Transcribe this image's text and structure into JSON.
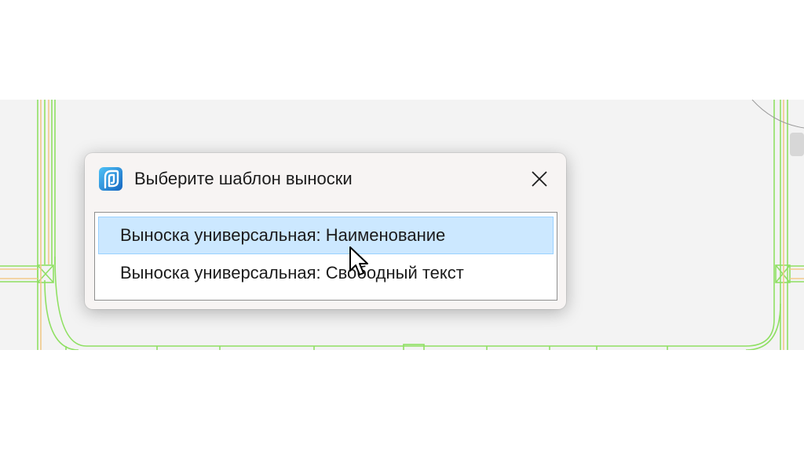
{
  "dialog": {
    "title": "Выберите шаблон выноски",
    "close_icon": "close-icon",
    "app_icon": "app-logo-icon",
    "items": [
      {
        "label": "Выноска универсальная: Наименование",
        "selected": true
      },
      {
        "label": "Выноска универсальная: Свободный текст",
        "selected": false
      }
    ]
  },
  "colors": {
    "selection_fill": "#cce8ff",
    "selection_border": "#99d1ff",
    "cad_line_green": "#8fe063",
    "cad_line_orange": "#f2c98a",
    "app_icon_blue": "#1e8fd8"
  }
}
